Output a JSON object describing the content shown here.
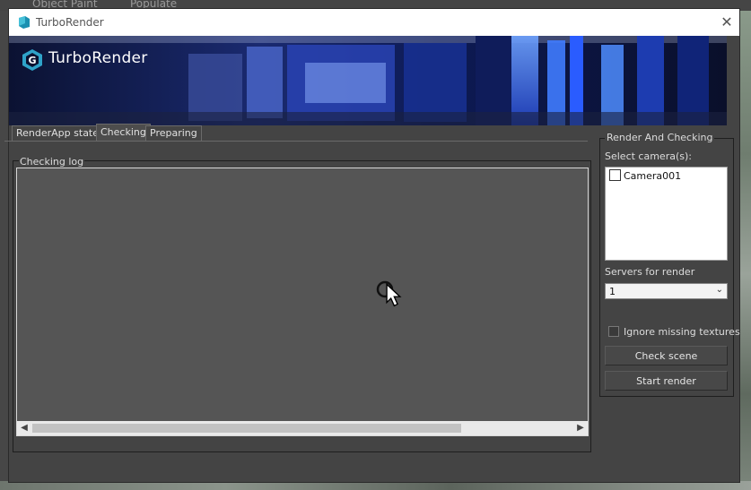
{
  "background_app": {
    "menu_items": [
      "Object Paint",
      "Populate"
    ]
  },
  "window": {
    "title": "TurboRender",
    "close_glyph": "✕"
  },
  "banner": {
    "logo_text": "TurboRender",
    "logo_icon": "turborender-logo-icon"
  },
  "tabs": [
    {
      "label": "RenderApp state",
      "active": false
    },
    {
      "label": "Checking",
      "active": true
    },
    {
      "label": "Preparing",
      "active": false
    }
  ],
  "log": {
    "group_label": "Checking log",
    "content": ""
  },
  "render_panel": {
    "group_label": "Render And Checking",
    "cameras_label": "Select camera(s):",
    "cameras": [
      {
        "name": "Camera001",
        "checked": false
      }
    ],
    "servers_label": "Servers for render",
    "servers_value": "1",
    "ignore_label": "Ignore missing textures",
    "ignore_checked": false,
    "check_button": "Check scene",
    "start_button": "Start render"
  },
  "colors": {
    "dialog_bg": "#444444",
    "log_bg": "#555555",
    "banner_blue": "#2a5cff"
  }
}
